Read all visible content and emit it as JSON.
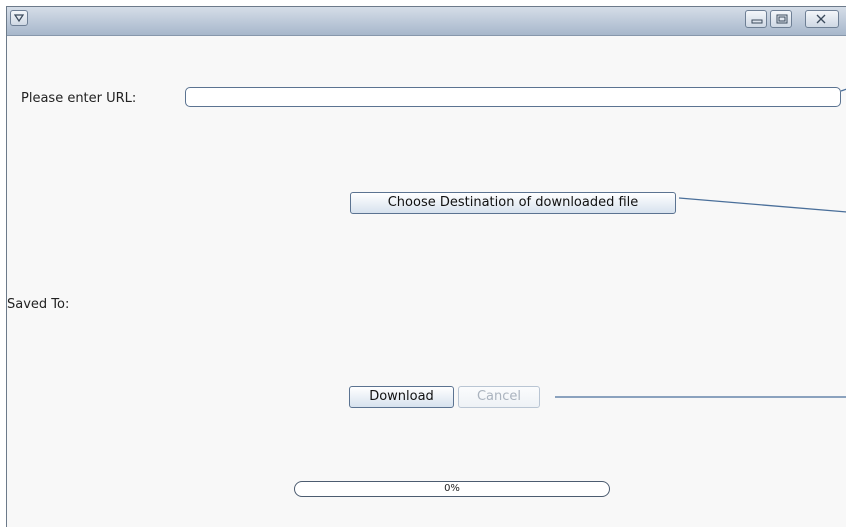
{
  "url_label": "Please enter URL:",
  "url_value": "",
  "choose_button": "Choose Destination of downloaded file",
  "saved_to_label": "Saved To:",
  "download_button": "Download",
  "cancel_button": "Cancel",
  "progress": {
    "value": 0,
    "text": "0%"
  }
}
